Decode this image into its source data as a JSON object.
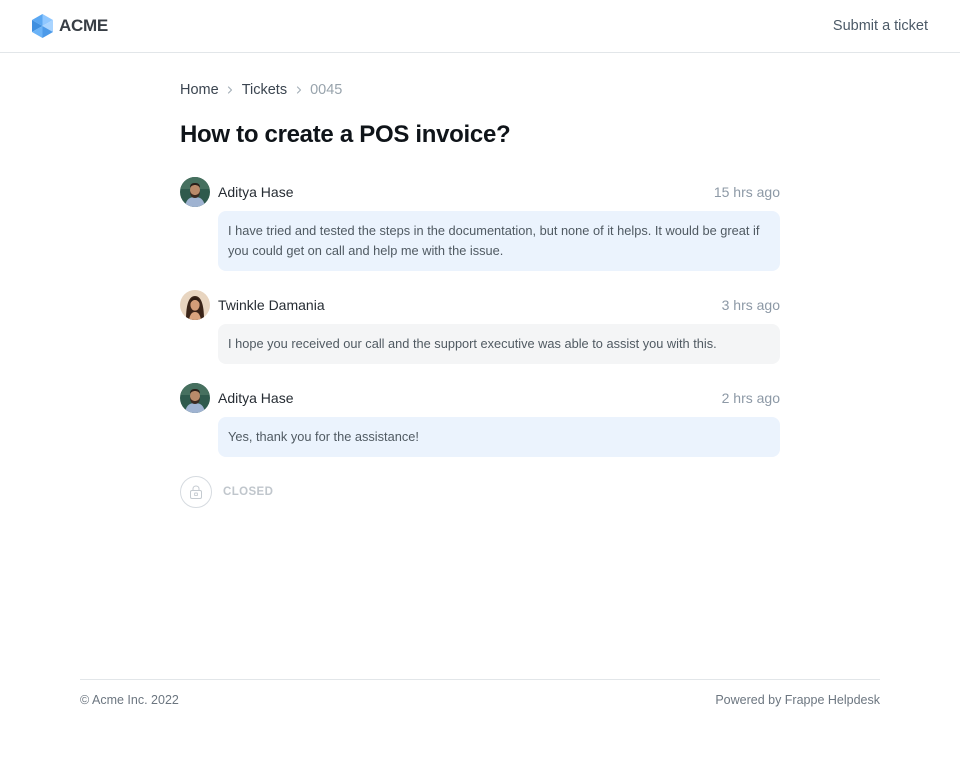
{
  "navbar": {
    "brand_name": "ACME",
    "submit_link": "Submit a ticket"
  },
  "breadcrumb": [
    {
      "label": "Home"
    },
    {
      "label": "Tickets"
    },
    {
      "label": "0045"
    }
  ],
  "ticket": {
    "title": "How to create a POS invoice?",
    "status": "CLOSED"
  },
  "comments": [
    {
      "author": "Aditya Hase",
      "time": "15 hrs ago",
      "text": "I have tried and tested the steps in the documentation, but none of it helps. It would be great if you could get on call and help me with the issue."
    },
    {
      "author": "Twinkle Damania",
      "time": "3 hrs ago",
      "text": "I hope you received our call and the support executive was able to assist you with this."
    },
    {
      "author": "Aditya Hase",
      "time": "2 hrs ago",
      "text": "Yes, thank you for the assistance!"
    }
  ],
  "footer": {
    "copyright": "© Acme Inc. 2022",
    "powered_by": "Powered by Frappe Helpdesk"
  },
  "colors": {
    "customer_bubble": "#ebf3fd",
    "agent_bubble": "#f4f5f6",
    "brand_logo": "#5aa7f2"
  }
}
